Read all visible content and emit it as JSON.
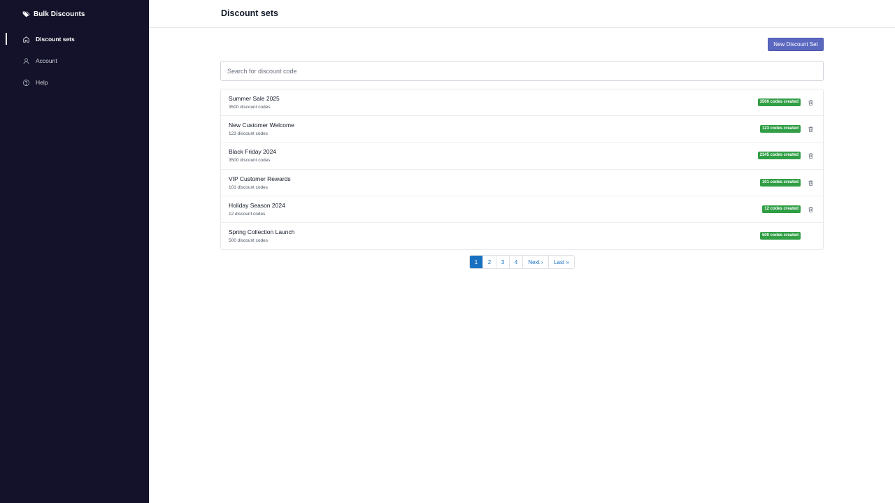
{
  "app": {
    "name": "Bulk Discounts"
  },
  "sidebar": {
    "items": [
      {
        "label": "Discount sets",
        "icon": "home-icon",
        "active": true
      },
      {
        "label": "Account",
        "icon": "user-icon",
        "active": false
      },
      {
        "label": "Help",
        "icon": "help-circle-icon",
        "active": false
      }
    ]
  },
  "header": {
    "title": "Discount sets"
  },
  "toolbar": {
    "new_label": "New Discount Set"
  },
  "search": {
    "placeholder": "Search for discount code",
    "value": ""
  },
  "discount_sets": [
    {
      "name": "Summer Sale 2025",
      "sub": "3500 discount codes",
      "badge": "3500 codes created",
      "deletable": true
    },
    {
      "name": "New Customer Welcome",
      "sub": "123 discount codes",
      "badge": "123 codes created",
      "deletable": true
    },
    {
      "name": "Black Friday 2024",
      "sub": "3500 discount codes",
      "badge": "2345 codes created",
      "deletable": true
    },
    {
      "name": "VIP Customer Rewards",
      "sub": "101 discount codes",
      "badge": "101 codes created",
      "deletable": true
    },
    {
      "name": "Holiday Season 2024",
      "sub": "12 discount codes",
      "badge": "12 codes created",
      "deletable": true
    },
    {
      "name": "Spring Collection Launch",
      "sub": "500 discount codes",
      "badge": "500 codes created",
      "deletable": false
    }
  ],
  "pagination": {
    "pages": [
      "1",
      "2",
      "3",
      "4"
    ],
    "current": "1",
    "next_label": "Next ›",
    "last_label": "Last »"
  },
  "colors": {
    "sidebar_bg": "#13122a",
    "primary_button": "#5b68c0",
    "badge_success": "#2f9e44",
    "pagination_active": "#1971c2"
  }
}
